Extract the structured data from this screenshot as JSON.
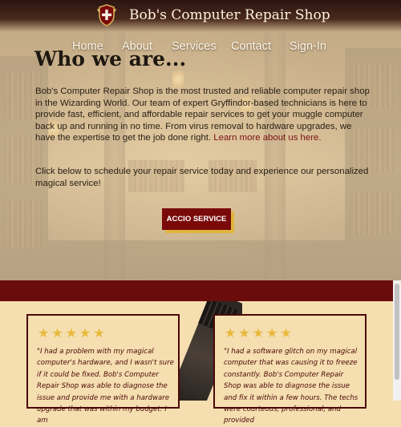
{
  "header": {
    "title": "Bob's Computer Repair Shop"
  },
  "nav": {
    "items": [
      "Home",
      "About",
      "Services",
      "Contact",
      "Sign-In"
    ]
  },
  "about": {
    "heading": "Who we are...",
    "paragraph": "Bob's Computer Repair Shop is the most trusted and reliable computer repair shop in the Wizarding World. Our team of expert Gryffindor-based technicians is here to provide fast, efficient, and affordable repair services to get your muggle computer back up and running in no time. From virus removal to hardware upgrades, we have the expertise to get the job done right.",
    "learn_more": "Learn more about us here.",
    "cta_text": "Click below to schedule your repair service today and experience our personalized magical service!",
    "button_label": "ACCIO SERVICE"
  },
  "reviews": [
    {
      "stars": "★★★★★",
      "rating": 5,
      "text": "\"I had a problem with my magical computer's hardware, and I wasn't sure if it could be fixed. Bob's Computer Repair Shop was able to diagnose the issue and provide me with a hardware upgrade that was within my budget. I am"
    },
    {
      "stars": "★★★★★",
      "rating": 5,
      "text": "\"I had a software glitch on my magical computer that was causing it to freeze constantly. Bob's Computer Repair Shop was able to diagnose the issue and fix it within a few hours. The techs were courteous, professional, and provided"
    }
  ],
  "colors": {
    "brand_red": "#7a0a0a",
    "band": "#6a0c0c",
    "gold": "#e0b43a",
    "parchment": "#f5deb0"
  },
  "icons": {
    "logo": "gryffindor-crest-icon"
  }
}
